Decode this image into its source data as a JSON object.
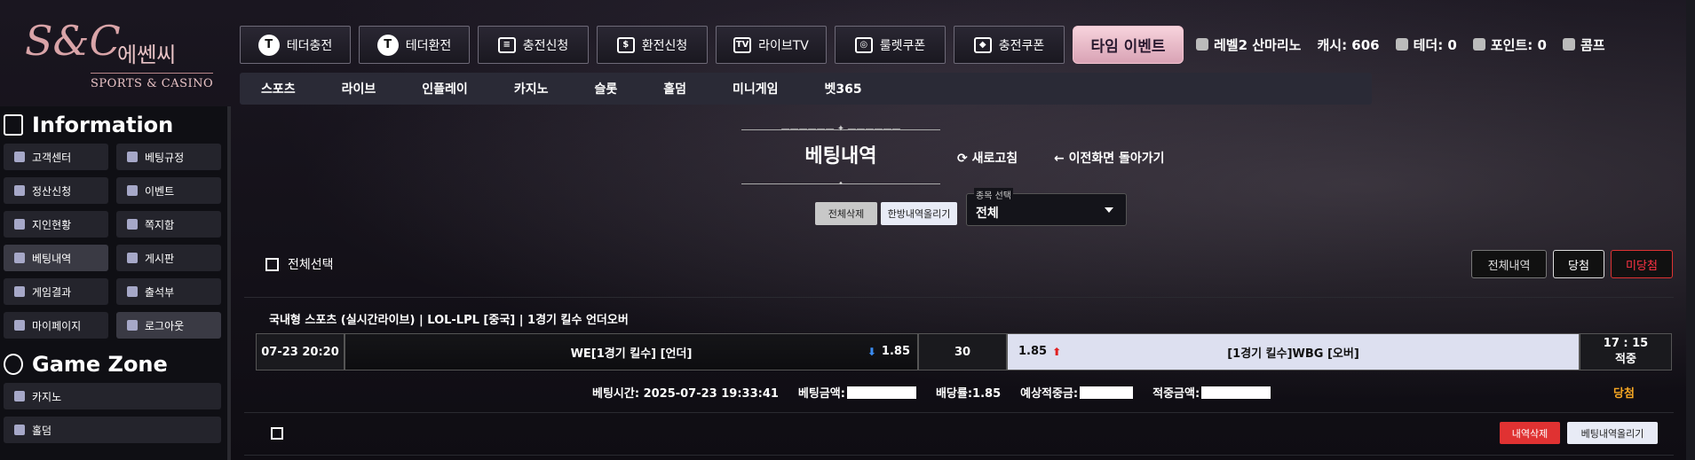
{
  "logo": {
    "mono": "S&C",
    "korean": "에쎈씨",
    "english": "SPORTS & CASINO"
  },
  "topbar": {
    "buttons": [
      {
        "label": "테더충전",
        "icon": "tether-charge-icon",
        "glyph": "T"
      },
      {
        "label": "테더환전",
        "icon": "tether-exchange-icon",
        "glyph": "T"
      },
      {
        "label": "충전신청",
        "icon": "coins-icon",
        "glyph": "≡"
      },
      {
        "label": "환전신청",
        "icon": "money-icon",
        "glyph": "$"
      },
      {
        "label": "라이브TV",
        "icon": "tv-icon",
        "glyph": "TV"
      },
      {
        "label": "룰렛쿠폰",
        "icon": "roulette-icon",
        "glyph": "◎"
      },
      {
        "label": "충전쿠폰",
        "icon": "coupon-icon",
        "glyph": "◆"
      }
    ],
    "event_label": "타임 이벤트"
  },
  "user": {
    "level": "레벨2 산마리노",
    "cash": "캐시: 606",
    "tether": "테더: 0",
    "points": "포인트: 0",
    "comp": "콤프"
  },
  "subnav": [
    "스포츠",
    "라이브",
    "인플레이",
    "카지노",
    "슬롯",
    "홀덤",
    "미니게임",
    "벳365"
  ],
  "sidebar": {
    "info_title": "Information",
    "info_items": [
      {
        "label": "고객센터",
        "icon": "phone-icon"
      },
      {
        "label": "베팅규정",
        "icon": "rules-icon"
      },
      {
        "label": "정산신청",
        "icon": "settle-icon"
      },
      {
        "label": "이벤트",
        "icon": "event-icon"
      },
      {
        "label": "지인현황",
        "icon": "friends-icon"
      },
      {
        "label": "쪽지함",
        "icon": "message-icon"
      },
      {
        "label": "베팅내역",
        "icon": "history-icon"
      },
      {
        "label": "게시판",
        "icon": "board-icon"
      },
      {
        "label": "게임결과",
        "icon": "result-icon"
      },
      {
        "label": "출석부",
        "icon": "attendance-icon"
      },
      {
        "label": "마이페이지",
        "icon": "mypage-icon"
      },
      {
        "label": "로그아웃",
        "icon": "power-icon"
      }
    ],
    "game_title": "Game Zone",
    "game_items": [
      {
        "label": "카지노",
        "icon": "diamond-icon"
      },
      {
        "label": "홀덤",
        "icon": "cards-icon"
      }
    ]
  },
  "main": {
    "title": "베팅내역",
    "refresh": "새로고침",
    "back": "이전화면 돌아가기",
    "delete_all": "전체삭제",
    "upload_all": "한방내역올리기",
    "select_label": "종목 선택",
    "select_value": "전체",
    "select_all": "전체선택",
    "filters": {
      "all": "전체내역",
      "win": "당첨",
      "lose": "미당첨"
    },
    "bet": {
      "match_title": "국내형 스포츠 (실시간라이브) | LOL-LPL [중국] | 1경기 킬수 언더오버",
      "date": "07-23 20:20",
      "home": "WE[1경기 킬수] [언더]",
      "home_odds": "1.85",
      "line": "30",
      "away_odds": "1.85",
      "away": "[1경기 킬수]WBG [오버]",
      "score": "17 : 15",
      "status": "적중",
      "bet_time": "베팅시간: 2025-07-23 19:33:41",
      "bet_amount_label": "베팅금액:",
      "bet_odds": "배당률:1.85",
      "expected_label": "예상적중금:",
      "win_amount_label": "적중금액:",
      "result": "당첨"
    },
    "row_delete": "내역삭제",
    "row_upload": "베팅내역올리기"
  }
}
